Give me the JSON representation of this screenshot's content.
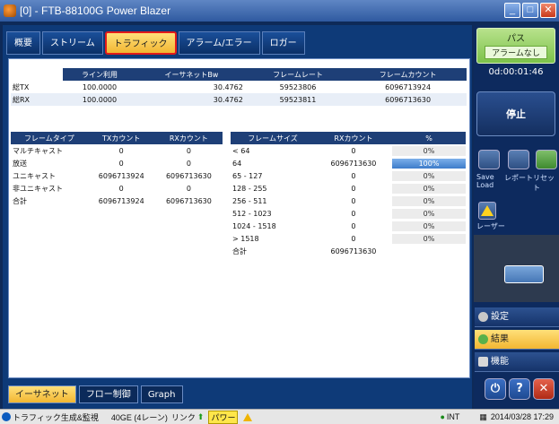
{
  "window": {
    "title": "[0] - FTB-88100G Power Blazer"
  },
  "tabs": [
    "概要",
    "ストリーム",
    "トラフィック",
    "アラーム/エラー",
    "ロガー"
  ],
  "active_tab": "トラフィック",
  "stats_table": {
    "headers": [
      "",
      "ライン利用",
      "イーサネットBw",
      "フレームレート",
      "フレームカウント"
    ],
    "rows": [
      [
        "総TX",
        "100.0000",
        "30.4762",
        "59523806",
        "6096713924"
      ],
      [
        "総RX",
        "100.0000",
        "30.4762",
        "59523811",
        "6096713630"
      ]
    ]
  },
  "frames_table": {
    "headers": [
      "フレームタイプ",
      "TXカウント",
      "RXカウント"
    ],
    "rows": [
      [
        "マルチキャスト",
        "0",
        "0"
      ],
      [
        "放送",
        "0",
        "0"
      ],
      [
        "ユニキャスト",
        "6096713924",
        "6096713630"
      ],
      [
        "非ユニキャスト",
        "0",
        "0"
      ],
      [
        "合計",
        "6096713924",
        "6096713630"
      ]
    ]
  },
  "sizes_table": {
    "headers": [
      "フレームサイズ",
      "RXカウント",
      "%"
    ],
    "rows": [
      {
        "size": "< 64",
        "rx": "0",
        "pct": "0%",
        "fill": 0
      },
      {
        "size": "64",
        "rx": "6096713630",
        "pct": "100%",
        "fill": 100
      },
      {
        "size": "65 - 127",
        "rx": "0",
        "pct": "0%",
        "fill": 0
      },
      {
        "size": "128 - 255",
        "rx": "0",
        "pct": "0%",
        "fill": 0
      },
      {
        "size": "256 - 511",
        "rx": "0",
        "pct": "0%",
        "fill": 0
      },
      {
        "size": "512 - 1023",
        "rx": "0",
        "pct": "0%",
        "fill": 0
      },
      {
        "size": "1024 - 1518",
        "rx": "0",
        "pct": "0%",
        "fill": 0
      },
      {
        "size": "> 1518",
        "rx": "0",
        "pct": "0%",
        "fill": 0
      }
    ],
    "total_label": "合計",
    "total_rx": "6096713630"
  },
  "bottom_tabs": [
    "イーサネット",
    "フロー制御",
    "Graph"
  ],
  "right": {
    "status": "パス",
    "alarm": "アラームなし",
    "timer": "0d:00:01:46",
    "stop": "停止",
    "save_label": "Save\nLoad",
    "report_label": "レポート",
    "reset_label": "リセット",
    "laser_label": "レーザー",
    "menu": [
      "設定",
      "結果",
      "機能"
    ]
  },
  "statusbar": {
    "gen": "トラフィック生成&監視",
    "link_info": "40GE (4レーン)",
    "link": "リンク",
    "power": "パワー",
    "clock_source": "INT",
    "datetime": "2014/03/28 17:29"
  },
  "colors": {
    "accent": "#f2b632",
    "header": "#1e3f77",
    "status_pass": "#7cc24a",
    "window": "#2f5aa0"
  }
}
